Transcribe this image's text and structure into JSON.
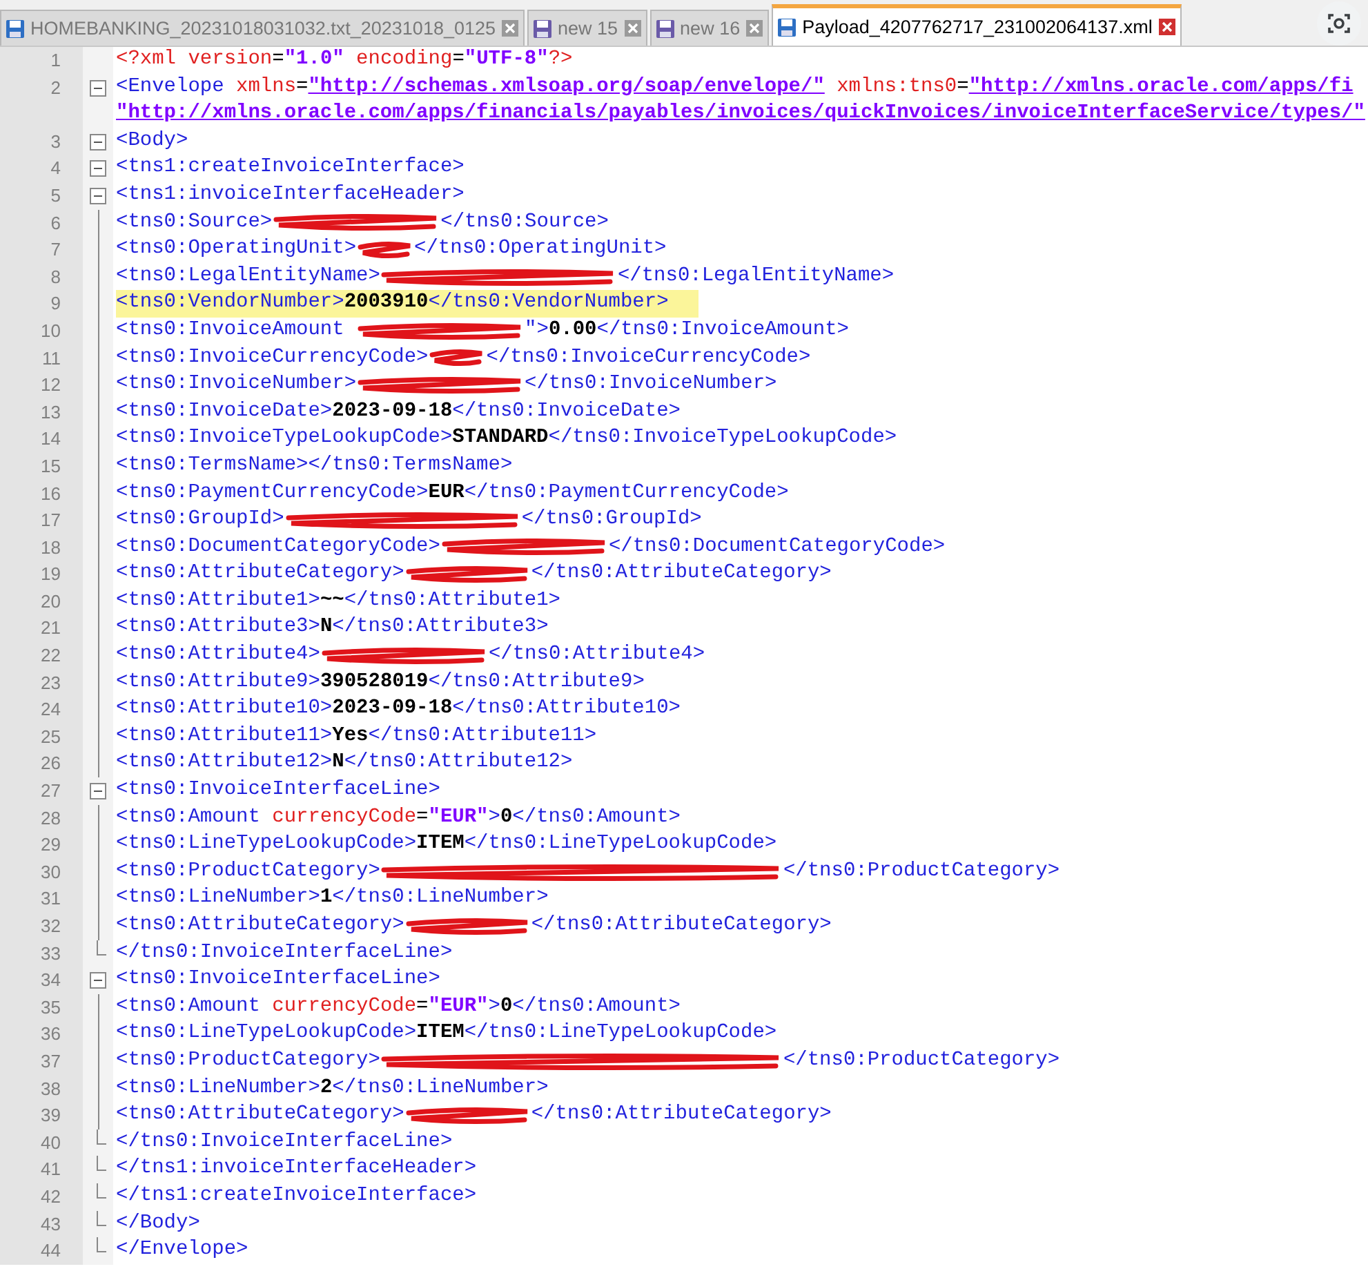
{
  "tabs": [
    {
      "label": "HOMEBANKING_20231018031032.txt_20231018_0125",
      "selected": false,
      "kind": "file"
    },
    {
      "label": "new 15",
      "selected": false,
      "kind": "new"
    },
    {
      "label": "new 16",
      "selected": false,
      "kind": "new"
    },
    {
      "label": "Payload_4207762717_231002064137.xml",
      "selected": true,
      "kind": "file"
    }
  ],
  "lines": [
    {
      "number": "1",
      "kind": "plain",
      "highlighted": false,
      "tokens": [
        {
          "kind": "pi",
          "text": "<?xml "
        },
        {
          "kind": "attr",
          "text": "version"
        },
        {
          "kind": "eq",
          "text": "="
        },
        {
          "kind": "value",
          "text": "\"1.0\""
        },
        {
          "kind": "attr",
          "text": " encoding"
        },
        {
          "kind": "eq",
          "text": "="
        },
        {
          "kind": "value",
          "text": "\"UTF-8\""
        },
        {
          "kind": "pi",
          "text": "?>"
        }
      ]
    },
    {
      "number": "2",
      "kind": "start",
      "highlighted": false,
      "tokens": [
        {
          "kind": "tag",
          "text": "<Envelope "
        },
        {
          "kind": "attr",
          "text": "xmlns"
        },
        {
          "kind": "eq",
          "text": "="
        },
        {
          "kind": "url",
          "text": "\"http://schemas.xmlsoap.org/soap/envelope/\""
        },
        {
          "kind": "attr",
          "text": " xmlns:tns0"
        },
        {
          "kind": "eq",
          "text": "="
        },
        {
          "kind": "url",
          "text": "\"http://xmlns.oracle.com/apps/fi"
        }
      ],
      "continuation": [
        {
          "kind": "url",
          "text": "\"http://xmlns.oracle.com/apps/financials/payables/invoices/quickInvoices/invoiceInterfaceService/types/\""
        }
      ]
    },
    {
      "number": "3",
      "kind": "start",
      "highlighted": false,
      "tokens": [
        {
          "kind": "tag",
          "text": "<Body>"
        }
      ]
    },
    {
      "number": "4",
      "kind": "start",
      "highlighted": false,
      "tokens": [
        {
          "kind": "tag",
          "text": "<tns1:createInvoiceInterface>"
        }
      ]
    },
    {
      "number": "5",
      "kind": "start",
      "highlighted": false,
      "tokens": [
        {
          "kind": "tag",
          "text": "<tns1:invoiceInterfaceHeader>"
        }
      ]
    },
    {
      "number": "6",
      "kind": "inner",
      "highlighted": false,
      "tokens": [
        {
          "kind": "tag",
          "text": "<tns0:Source>"
        },
        {
          "kind": "long"
        },
        {
          "kind": "tag",
          "text": "</tns0:Source>"
        }
      ]
    },
    {
      "number": "7",
      "kind": "inner",
      "highlighted": false,
      "tokens": [
        {
          "kind": "tag",
          "text": "<tns0:OperatingUnit>"
        },
        {
          "kind": "short"
        },
        {
          "kind": "tag",
          "text": "</tns0:OperatingUnit>"
        }
      ]
    },
    {
      "number": "8",
      "kind": "inner",
      "highlighted": false,
      "tokens": [
        {
          "kind": "tag",
          "text": "<tns0:LegalEntityName>"
        },
        {
          "kind": "wider"
        },
        {
          "kind": "tag",
          "text": "</tns0:LegalEntityName>"
        }
      ]
    },
    {
      "number": "9",
      "kind": "inner",
      "highlighted": true,
      "tokens": [
        {
          "kind": "tag",
          "text": "<tns0:VendorNumber>"
        },
        {
          "kind": "text",
          "text": "2003910"
        },
        {
          "kind": "tag",
          "text": "</tns0:VendorNumber>"
        }
      ]
    },
    {
      "number": "10",
      "kind": "inner",
      "highlighted": false,
      "tokens": [
        {
          "kind": "tag",
          "text": "<tns0:InvoiceAmount "
        },
        {
          "kind": "long"
        },
        {
          "kind": "tag",
          "text": "\">"
        },
        {
          "kind": "text",
          "text": "0.00"
        },
        {
          "kind": "tag",
          "text": "</tns0:InvoiceAmount>"
        }
      ]
    },
    {
      "number": "11",
      "kind": "inner",
      "highlighted": false,
      "tokens": [
        {
          "kind": "tag",
          "text": "<tns0:InvoiceCurrencyCode>"
        },
        {
          "kind": "short"
        },
        {
          "kind": "tag",
          "text": "</tns0:InvoiceCurrencyCode>"
        }
      ]
    },
    {
      "number": "12",
      "kind": "inner",
      "highlighted": false,
      "tokens": [
        {
          "kind": "tag",
          "text": "<tns0:InvoiceNumber>"
        },
        {
          "kind": "long"
        },
        {
          "kind": "tag",
          "text": "</tns0:InvoiceNumber>"
        }
      ]
    },
    {
      "number": "13",
      "kind": "inner",
      "highlighted": false,
      "tokens": [
        {
          "kind": "tag",
          "text": "<tns0:InvoiceDate>"
        },
        {
          "kind": "text",
          "text": "2023-09-18"
        },
        {
          "kind": "tag",
          "text": "</tns0:InvoiceDate>"
        }
      ]
    },
    {
      "number": "14",
      "kind": "inner",
      "highlighted": false,
      "tokens": [
        {
          "kind": "tag",
          "text": "<tns0:InvoiceTypeLookupCode>"
        },
        {
          "kind": "text",
          "text": "STANDARD"
        },
        {
          "kind": "tag",
          "text": "</tns0:InvoiceTypeLookupCode>"
        }
      ]
    },
    {
      "number": "15",
      "kind": "inner",
      "highlighted": false,
      "tokens": [
        {
          "kind": "tag",
          "text": "<tns0:TermsName></tns0:TermsName>"
        }
      ]
    },
    {
      "number": "16",
      "kind": "inner",
      "highlighted": false,
      "tokens": [
        {
          "kind": "tag",
          "text": "<tns0:PaymentCurrencyCode>"
        },
        {
          "kind": "text",
          "text": "EUR"
        },
        {
          "kind": "tag",
          "text": "</tns0:PaymentCurrencyCode>"
        }
      ]
    },
    {
      "number": "17",
      "kind": "inner",
      "highlighted": false,
      "tokens": [
        {
          "kind": "tag",
          "text": "<tns0:GroupId>"
        },
        {
          "kind": "wider"
        },
        {
          "kind": "tag",
          "text": "</tns0:GroupId>"
        }
      ]
    },
    {
      "number": "18",
      "kind": "inner",
      "highlighted": false,
      "tokens": [
        {
          "kind": "tag",
          "text": "<tns0:DocumentCategoryCode>"
        },
        {
          "kind": "long"
        },
        {
          "kind": "tag",
          "text": "</tns0:DocumentCategoryCode>"
        }
      ]
    },
    {
      "number": "19",
      "kind": "inner",
      "highlighted": false,
      "tokens": [
        {
          "kind": "tag",
          "text": "<tns0:AttributeCategory>"
        },
        {
          "kind": "medium"
        },
        {
          "kind": "tag",
          "text": "</tns0:AttributeCategory>"
        }
      ]
    },
    {
      "number": "20",
      "kind": "inner",
      "highlighted": false,
      "tokens": [
        {
          "kind": "tag",
          "text": "<tns0:Attribute1>"
        },
        {
          "kind": "text",
          "text": "~~"
        },
        {
          "kind": "tag",
          "text": "</tns0:Attribute1>"
        }
      ]
    },
    {
      "number": "21",
      "kind": "inner",
      "highlighted": false,
      "tokens": [
        {
          "kind": "tag",
          "text": "<tns0:Attribute3>"
        },
        {
          "kind": "text",
          "text": "N"
        },
        {
          "kind": "tag",
          "text": "</tns0:Attribute3>"
        }
      ]
    },
    {
      "number": "22",
      "kind": "inner",
      "highlighted": false,
      "tokens": [
        {
          "kind": "tag",
          "text": "<tns0:Attribute4>"
        },
        {
          "kind": "long"
        },
        {
          "kind": "tag",
          "text": "</tns0:Attribute4>"
        }
      ]
    },
    {
      "number": "23",
      "kind": "inner",
      "highlighted": false,
      "tokens": [
        {
          "kind": "tag",
          "text": "<tns0:Attribute9>"
        },
        {
          "kind": "text",
          "text": "390528019"
        },
        {
          "kind": "tag",
          "text": "</tns0:Attribute9>"
        }
      ]
    },
    {
      "number": "24",
      "kind": "inner",
      "highlighted": false,
      "tokens": [
        {
          "kind": "tag",
          "text": "<tns0:Attribute10>"
        },
        {
          "kind": "text",
          "text": "2023-09-18"
        },
        {
          "kind": "tag",
          "text": "</tns0:Attribute10>"
        }
      ]
    },
    {
      "number": "25",
      "kind": "inner",
      "highlighted": false,
      "tokens": [
        {
          "kind": "tag",
          "text": "<tns0:Attribute11>"
        },
        {
          "kind": "text",
          "text": "Yes"
        },
        {
          "kind": "tag",
          "text": "</tns0:Attribute11>"
        }
      ]
    },
    {
      "number": "26",
      "kind": "inner",
      "highlighted": false,
      "tokens": [
        {
          "kind": "tag",
          "text": "<tns0:Attribute12>"
        },
        {
          "kind": "text",
          "text": "N"
        },
        {
          "kind": "tag",
          "text": "</tns0:Attribute12>"
        }
      ]
    },
    {
      "number": "27",
      "kind": "start",
      "highlighted": false,
      "tokens": [
        {
          "kind": "tag",
          "text": "<tns0:InvoiceInterfaceLine>"
        }
      ]
    },
    {
      "number": "28",
      "kind": "inner",
      "highlighted": false,
      "tokens": [
        {
          "kind": "tag",
          "text": "<tns0:Amount "
        },
        {
          "kind": "attr",
          "text": "currencyCode"
        },
        {
          "kind": "eq",
          "text": "="
        },
        {
          "kind": "value",
          "text": "\"EUR\""
        },
        {
          "kind": "tag",
          "text": ">"
        },
        {
          "kind": "text",
          "text": "0"
        },
        {
          "kind": "tag",
          "text": "</tns0:Amount>"
        }
      ]
    },
    {
      "number": "29",
      "kind": "inner",
      "highlighted": false,
      "tokens": [
        {
          "kind": "tag",
          "text": "<tns0:LineTypeLookupCode>"
        },
        {
          "kind": "text",
          "text": "ITEM"
        },
        {
          "kind": "tag",
          "text": "</tns0:LineTypeLookupCode>"
        }
      ]
    },
    {
      "number": "30",
      "kind": "inner",
      "highlighted": false,
      "tokens": [
        {
          "kind": "tag",
          "text": "<tns0:ProductCategory>"
        },
        {
          "kind": "widest"
        },
        {
          "kind": "tag",
          "text": "</tns0:ProductCategory>"
        }
      ]
    },
    {
      "number": "31",
      "kind": "inner",
      "highlighted": false,
      "tokens": [
        {
          "kind": "tag",
          "text": "<tns0:LineNumber>"
        },
        {
          "kind": "text",
          "text": "1"
        },
        {
          "kind": "tag",
          "text": "</tns0:LineNumber>"
        }
      ]
    },
    {
      "number": "32",
      "kind": "inner",
      "highlighted": false,
      "tokens": [
        {
          "kind": "tag",
          "text": "<tns0:AttributeCategory>"
        },
        {
          "kind": "medium"
        },
        {
          "kind": "tag",
          "text": "</tns0:AttributeCategory>"
        }
      ]
    },
    {
      "number": "33",
      "kind": "end",
      "highlighted": false,
      "tokens": [
        {
          "kind": "tag",
          "text": "</tns0:InvoiceInterfaceLine>"
        }
      ]
    },
    {
      "number": "34",
      "kind": "start",
      "highlighted": false,
      "tokens": [
        {
          "kind": "tag",
          "text": "<tns0:InvoiceInterfaceLine>"
        }
      ]
    },
    {
      "number": "35",
      "kind": "inner",
      "highlighted": false,
      "tokens": [
        {
          "kind": "tag",
          "text": "<tns0:Amount "
        },
        {
          "kind": "attr",
          "text": "currencyCode"
        },
        {
          "kind": "eq",
          "text": "="
        },
        {
          "kind": "value",
          "text": "\"EUR\""
        },
        {
          "kind": "tag",
          "text": ">"
        },
        {
          "kind": "text",
          "text": "0"
        },
        {
          "kind": "tag",
          "text": "</tns0:Amount>"
        }
      ]
    },
    {
      "number": "36",
      "kind": "inner",
      "highlighted": false,
      "tokens": [
        {
          "kind": "tag",
          "text": "<tns0:LineTypeLookupCode>"
        },
        {
          "kind": "text",
          "text": "ITEM"
        },
        {
          "kind": "tag",
          "text": "</tns0:LineTypeLookupCode>"
        }
      ]
    },
    {
      "number": "37",
      "kind": "inner",
      "highlighted": false,
      "tokens": [
        {
          "kind": "tag",
          "text": "<tns0:ProductCategory>"
        },
        {
          "kind": "widest"
        },
        {
          "kind": "tag",
          "text": "</tns0:ProductCategory>"
        }
      ]
    },
    {
      "number": "38",
      "kind": "inner",
      "highlighted": false,
      "tokens": [
        {
          "kind": "tag",
          "text": "<tns0:LineNumber>"
        },
        {
          "kind": "text",
          "text": "2"
        },
        {
          "kind": "tag",
          "text": "</tns0:LineNumber>"
        }
      ]
    },
    {
      "number": "39",
      "kind": "inner",
      "highlighted": false,
      "tokens": [
        {
          "kind": "tag",
          "text": "<tns0:AttributeCategory>"
        },
        {
          "kind": "medium"
        },
        {
          "kind": "tag",
          "text": "</tns0:AttributeCategory>"
        }
      ]
    },
    {
      "number": "40",
      "kind": "end",
      "highlighted": false,
      "tokens": [
        {
          "kind": "tag",
          "text": "</tns0:InvoiceInterfaceLine>"
        }
      ]
    },
    {
      "number": "41",
      "kind": "end",
      "highlighted": false,
      "tokens": [
        {
          "kind": "tag",
          "text": "</tns1:invoiceInterfaceHeader>"
        }
      ]
    },
    {
      "number": "42",
      "kind": "end",
      "highlighted": false,
      "tokens": [
        {
          "kind": "tag",
          "text": "</tns1:createInvoiceInterface>"
        }
      ]
    },
    {
      "number": "43",
      "kind": "end",
      "highlighted": false,
      "tokens": [
        {
          "kind": "tag",
          "text": "</Body>"
        }
      ]
    },
    {
      "number": "44",
      "kind": "end",
      "highlighted": false,
      "tokens": [
        {
          "kind": "tag",
          "text": "</Envelope>"
        }
      ]
    }
  ]
}
